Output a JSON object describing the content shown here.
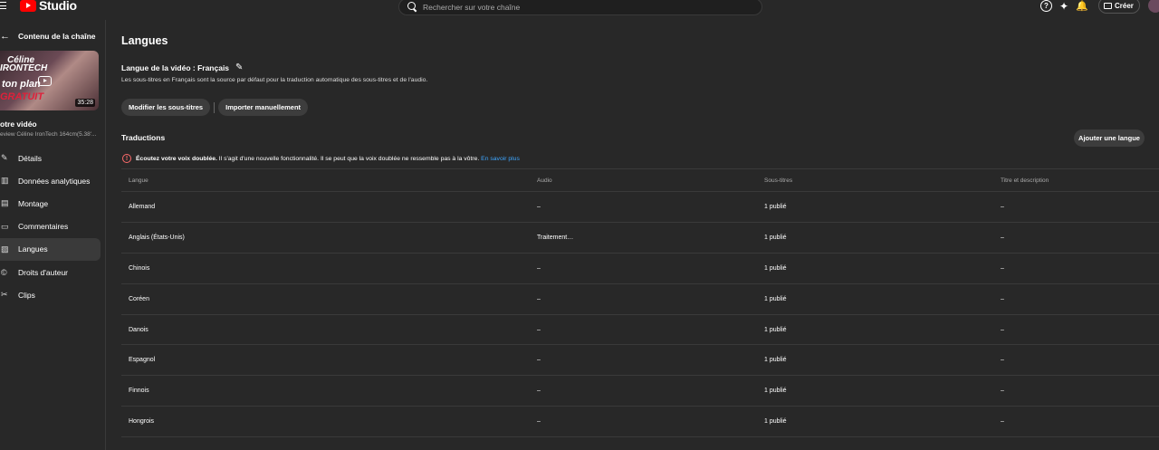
{
  "header": {
    "logo_text": "Studio",
    "search_placeholder": "Rechercher sur votre chaîne",
    "create_label": "Créer",
    "help_icon_glyph": "?",
    "spark_icon_glyph": "✦",
    "bell_icon_glyph": "🔔"
  },
  "sidebar": {
    "back_label": "Contenu de la chaîne",
    "thumbnail": {
      "line1": "Céline",
      "line2": "IRONTECH",
      "line3": "ton plan",
      "line4": "GRATUIT",
      "duration": "35:28"
    },
    "video_title": "otre vidéo",
    "video_subtitle": "eview Céline IronTech 164cm(5.38'...",
    "items": [
      {
        "label": "Détails",
        "icon": "✎"
      },
      {
        "label": "Données analytiques",
        "icon": "▥"
      },
      {
        "label": "Montage",
        "icon": "▤"
      },
      {
        "label": "Commentaires",
        "icon": "▭"
      },
      {
        "label": "Langues",
        "icon": "▨"
      },
      {
        "label": "Droits d'auteur",
        "icon": "©"
      },
      {
        "label": "Clips",
        "icon": "✂"
      }
    ]
  },
  "main": {
    "title": "Langues",
    "video_language": "Langue de la vidéo : Français",
    "description": "Les sous-titres en Français sont la source par défaut pour la traduction automatique des sous-titres et de l'audio.",
    "edit_subtitles": "Modifier les sous-titres",
    "import_manual": "Importer manuellement",
    "translations_title": "Traductions",
    "add_language": "Ajouter une langue",
    "notice_bold": "Écoutez votre voix doublée.",
    "notice_text": " Il s'agit d'une nouvelle fonctionnalité. Il se peut que la voix doublée ne ressemble pas à la vôtre. ",
    "notice_link": "En savoir plus",
    "table": {
      "headers": [
        "Langue",
        "Audio",
        "Sous-titres",
        "Titre et description"
      ],
      "rows": [
        [
          "Allemand",
          "–",
          "1 publié",
          "–"
        ],
        [
          "Anglais (États-Unis)",
          "Traitement…",
          "1 publié",
          "–"
        ],
        [
          "Chinois",
          "–",
          "1 publié",
          "–"
        ],
        [
          "Coréen",
          "–",
          "1 publié",
          "–"
        ],
        [
          "Danois",
          "–",
          "1 publié",
          "–"
        ],
        [
          "Espagnol",
          "–",
          "1 publié",
          "–"
        ],
        [
          "Finnois",
          "–",
          "1 publié",
          "–"
        ],
        [
          "Hongrois",
          "–",
          "1 publié",
          "–"
        ]
      ]
    }
  },
  "colors": {
    "background": "#282828",
    "link": "#3ea6ff",
    "warning": "#ff6b6b",
    "brand_red": "#ff0000"
  }
}
